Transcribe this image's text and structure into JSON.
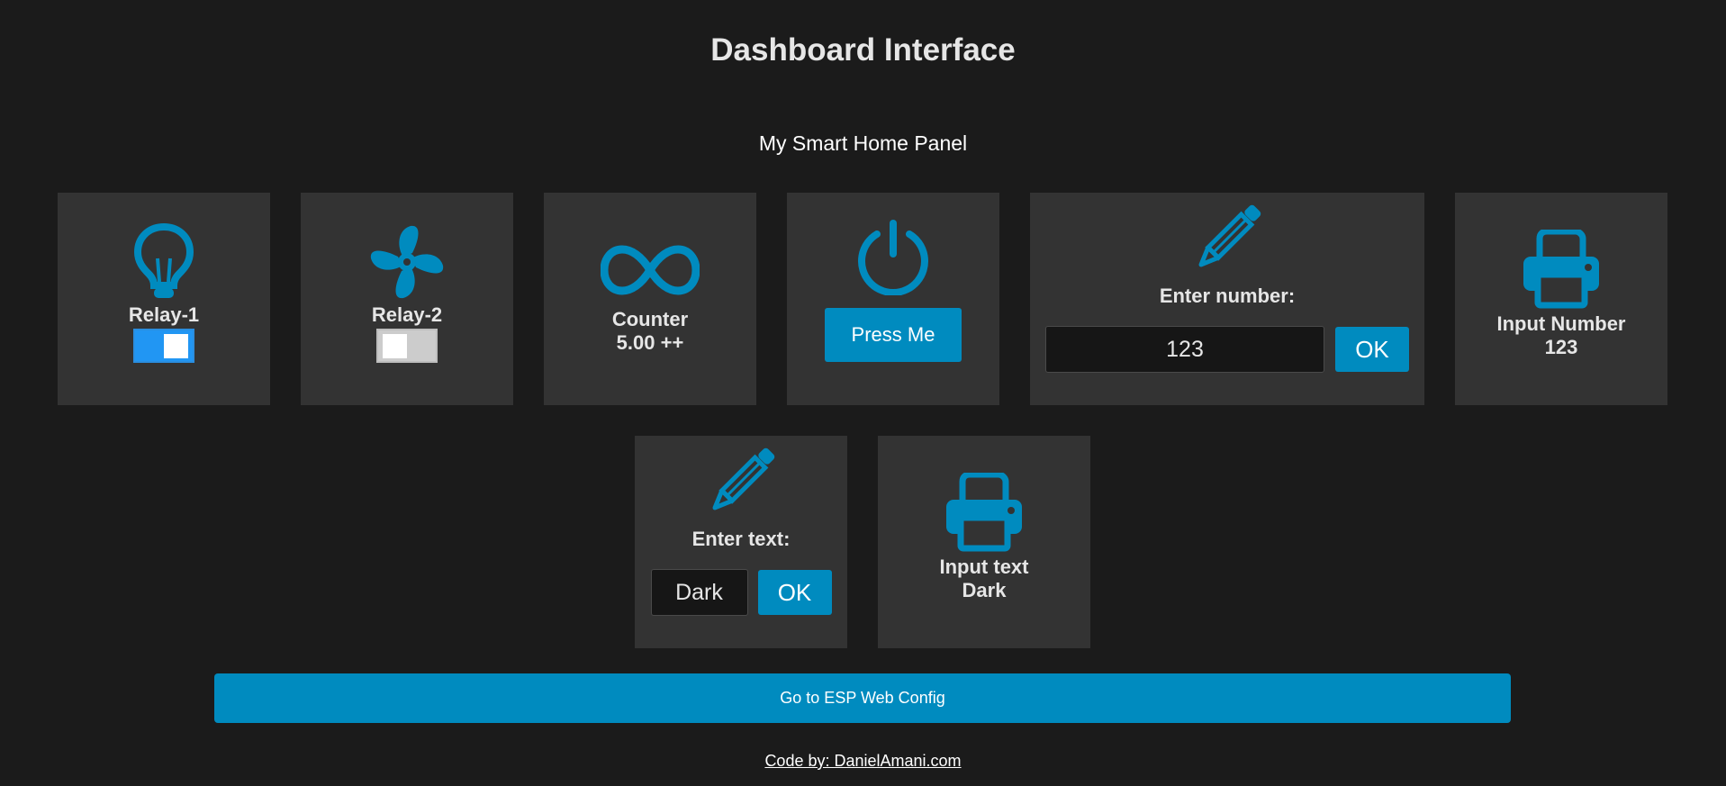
{
  "page": {
    "title": "Dashboard Interface",
    "subtitle": "My Smart Home Panel"
  },
  "colors": {
    "background": "#1b1b1b",
    "card": "#333333",
    "accent": "#008bbf",
    "switch_on": "#2196f3"
  },
  "cards": {
    "relay1": {
      "label": "Relay-1",
      "icon": "lightbulb-icon",
      "state": "on"
    },
    "relay2": {
      "label": "Relay-2",
      "icon": "fan-icon",
      "state": "off"
    },
    "counter": {
      "label": "Counter",
      "value": "5.00 ++",
      "icon": "infinity-icon"
    },
    "press": {
      "icon": "power-icon",
      "button_label": "Press Me"
    },
    "number_input": {
      "label": "Enter number:",
      "icon": "pencil-icon",
      "value": "123",
      "button_label": "OK"
    },
    "number_display": {
      "label": "Input Number",
      "value": "123",
      "icon": "printer-icon"
    },
    "text_input": {
      "label": "Enter text:",
      "icon": "pencil-icon",
      "value": "Dark",
      "button_label": "OK"
    },
    "text_display": {
      "label": "Input text",
      "value": "Dark",
      "icon": "printer-icon"
    }
  },
  "config_button": {
    "label": "Go to ESP Web Config"
  },
  "footer": {
    "link_text": "Code by: DanielAmani.com"
  }
}
